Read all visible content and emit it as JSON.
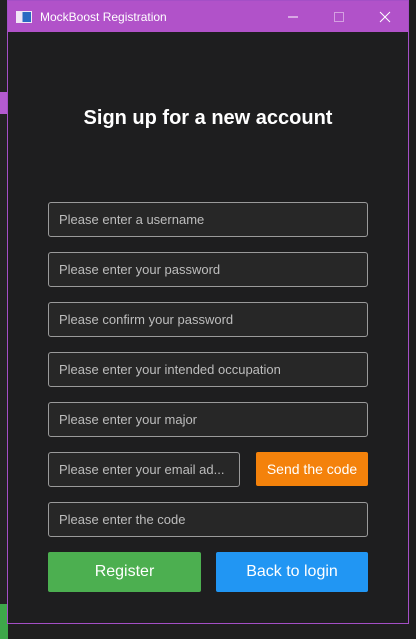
{
  "window": {
    "title": "MockBoost Registration",
    "controls": {
      "minimize_icon": "minimize-icon",
      "maximize_icon": "maximize-icon",
      "close_icon": "close-icon"
    }
  },
  "form": {
    "heading": "Sign up for a new account",
    "fields": {
      "username": {
        "value": "",
        "placeholder": "Please enter a username"
      },
      "password": {
        "value": "",
        "placeholder": "Please enter your password"
      },
      "confirm_password": {
        "value": "",
        "placeholder": "Please confirm your password"
      },
      "occupation": {
        "value": "",
        "placeholder": "Please enter your intended occupation"
      },
      "major": {
        "value": "",
        "placeholder": "Please enter your major"
      },
      "email": {
        "value": "",
        "placeholder": "Please enter your email ad..."
      },
      "code": {
        "value": "",
        "placeholder": "Please enter the code"
      }
    },
    "buttons": {
      "send_code": "Send the code",
      "register": "Register",
      "back_to_login": "Back to login"
    }
  },
  "colors": {
    "title_bar": "#b152c9",
    "send_code_button": "#f4820b",
    "register_button": "#4caf50",
    "back_button": "#2196f3"
  }
}
